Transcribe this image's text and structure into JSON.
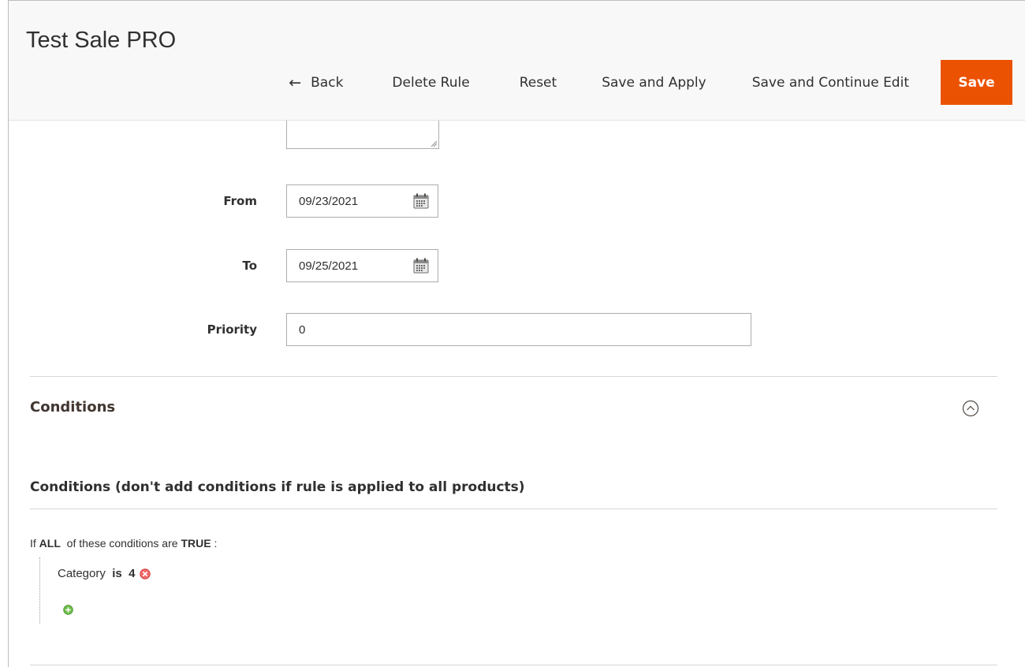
{
  "header": {
    "title": "Test Sale PRO",
    "actions": {
      "back_arrow": "←",
      "back": "Back",
      "delete": "Delete Rule",
      "reset": "Reset",
      "save_apply": "Save and Apply",
      "save_continue": "Save and Continue Edit",
      "save": "Save"
    }
  },
  "form": {
    "from_label": "From",
    "from_value": "09/23/2021",
    "to_label": "To",
    "to_value": "09/25/2021",
    "priority_label": "Priority",
    "priority_value": "0"
  },
  "conditions": {
    "section_title": "Conditions",
    "subsection_title": "Conditions (don't add conditions if rule is applied to all products)",
    "rule_prefix": "If",
    "rule_aggregator": "ALL",
    "rule_middle": "of these conditions are",
    "rule_value": "TRUE",
    "rule_suffix": ":",
    "items": [
      {
        "attribute": "Category",
        "operator": "is",
        "value": "4"
      }
    ]
  },
  "colors": {
    "primary_button": "#eb5202",
    "remove_icon": "#e22626",
    "add_icon": "#4f9a3a"
  }
}
